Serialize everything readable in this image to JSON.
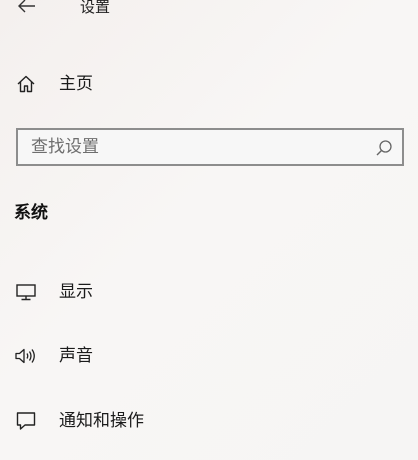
{
  "window": {
    "title": "设置",
    "back_icon": "back-arrow-icon"
  },
  "home": {
    "label": "主页",
    "icon": "home-icon"
  },
  "search": {
    "placeholder": "查找设置",
    "value": "",
    "icon": "search-icon"
  },
  "section": {
    "title": "系统"
  },
  "nav": {
    "items": [
      {
        "label": "显示",
        "icon": "display-icon"
      },
      {
        "label": "声音",
        "icon": "speaker-icon"
      },
      {
        "label": "通知和操作",
        "icon": "notification-icon"
      }
    ]
  },
  "colors": {
    "text": "#1b1b1b",
    "search_border": "#8d8d8d",
    "placeholder": "#6e6e6e",
    "background": "#f6f4f3"
  }
}
